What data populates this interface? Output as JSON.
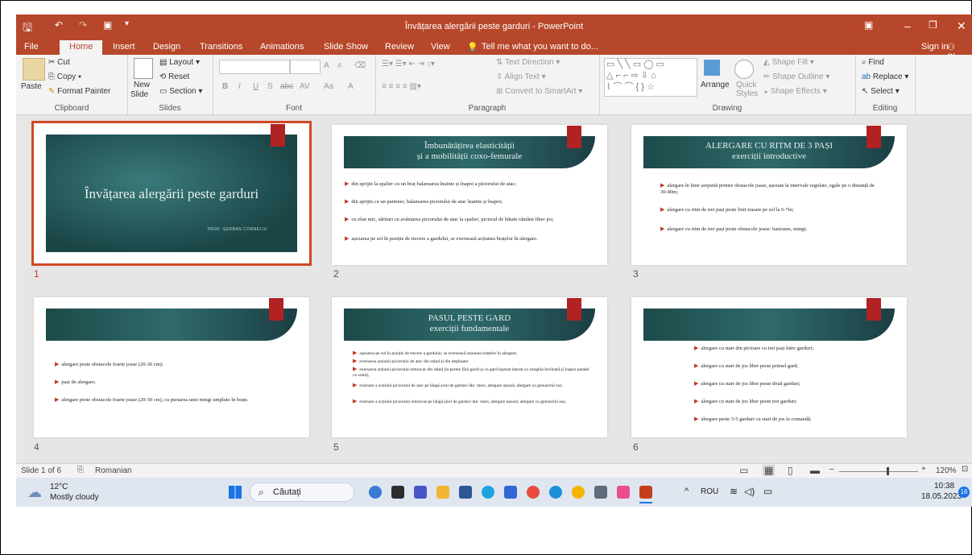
{
  "window": {
    "title": "Învățarea alergării peste garduri - PowerPoint"
  },
  "tabs": [
    "File",
    "Home",
    "Insert",
    "Design",
    "Transitions",
    "Animations",
    "Slide Show",
    "Review",
    "View"
  ],
  "tell_me": "Tell me what you want to do...",
  "account": {
    "signin": "Sign in",
    "share": "Share"
  },
  "ribbon": {
    "clipboard": {
      "paste": "Paste",
      "cut": "Cut",
      "copy": "Copy",
      "format_painter": "Format Painter",
      "label": "Clipboard"
    },
    "slides": {
      "new_slide_1": "New",
      "new_slide_2": "Slide",
      "layout": "Layout",
      "reset": "Reset",
      "section": "Section",
      "label": "Slides"
    },
    "font": {
      "label": "Font",
      "bold": "B",
      "italic": "I",
      "underline": "U",
      "shadow": "S",
      "strike": "abc",
      "spacing": "AV",
      "case": "Aa",
      "grow": "A",
      "shrink": "A",
      "color": "A"
    },
    "paragraph": {
      "label": "Paragraph",
      "text_direction": "Text Direction",
      "align_text": "Align Text",
      "smartart": "Convert to SmartArt"
    },
    "drawing": {
      "label": "Drawing",
      "arrange": "Arrange",
      "quick_styles_1": "Quick",
      "quick_styles_2": "Styles",
      "fill": "Shape Fill",
      "outline": "Shape Outline",
      "effects": "Shape Effects"
    },
    "editing": {
      "label": "Editing",
      "find": "Find",
      "replace": "Replace",
      "select": "Select"
    }
  },
  "slides": [
    {
      "num": "1",
      "title": "Învățarea alergării peste garduri",
      "author": "PROF. ȘERBAN CORNELIU"
    },
    {
      "num": "2",
      "title1": "Îmbunătățirea  elasticității",
      "title2": "și a mobilității  coxo-femurale",
      "bullets": [
        "din sprijin la spalier cu un braț balansarea înainte și înapoi a piciorului de atac;",
        "din sprijin cu un partener, balansarea piciorului de atac înainte și înapoi;",
        "cu elan mic, sărituri cu avântarea piciorului de atac la spalier, piciorul de bătaie rămâne liber jos;",
        "așezarea pe sol în poziție de trecere a gardului, se exersează acțiunea brațelor în alergare."
      ]
    },
    {
      "num": "3",
      "title1": "ALERGARE  CU RITM DE 3 PAȘI",
      "title2": "exerciții  introductive",
      "bullets": [
        "alergare în linie șerpuită printre obstacole joase, așezate la intervale regulate, egale pe o distanță de 30-40m;",
        "alergare cu ritm de trei pași peste linii trasate pe sol la 6-7m;",
        "alergare cu ritm de trei pași peste obstacole joase: bastoane, mingi;"
      ]
    },
    {
      "num": "4",
      "bullets": [
        "alergare peste obstacole foarte joase (20-30 cm);",
        "pași de alergare;",
        "alergare peste obstacole foarte joase (20-30 cm), cu purtarea unei mingi umplute în brațe."
      ]
    },
    {
      "num": "5",
      "title1": "PASUL  PESTE  GARD",
      "title2": "exerciții  fundamentale",
      "bullets": [
        "așezarea pe sol în poziție de trecere a gardului; se exersează acțiunea brațelor în alergare;",
        "exersarea acțiunii piciorului de atac din stând și din deplasare",
        "exersarea acțiunii piciorului remorcat din stând (la perete fără gard) și cu gard (așezat lateral cu stinghia înclinată și înapoi paralel cu solul);",
        "exersare a acțiunii piciorului de atac pe lângă șirul de garduri din: mers, alergare ușoară, alergare cu genunchii sus;",
        "exersare a acțiunii piciorului remorcat pe lângă șirul de garduri din: mers, alergare ușoară, alergare cu genunchii sus;"
      ]
    },
    {
      "num": "6",
      "bullets": [
        "alergare cu start din picioare cu trei pași între garduri;",
        "alergare cu start de jos liber peste primul gard;",
        "alergare cu start de jos liber peste două garduri;",
        "alergare cu start de jos liber peste trei garduri;",
        "alergare peste 3-5 garduri cu start de jos la comandă;"
      ]
    }
  ],
  "status": {
    "slide": "Slide 1 of 6",
    "language": "Romanian",
    "zoom": "120%",
    "zoom_level": 0.6
  },
  "taskbar": {
    "temp": "12°C",
    "weather": "Mostly cloudy",
    "search": "Căutați",
    "lang": "ROU",
    "time": "10:38",
    "date": "18.05.2023",
    "badge": "16"
  },
  "colors": {
    "accent": "#b7472a",
    "selection": "#d24726",
    "banner": "#1f4d4d",
    "tag": "#b22222"
  }
}
